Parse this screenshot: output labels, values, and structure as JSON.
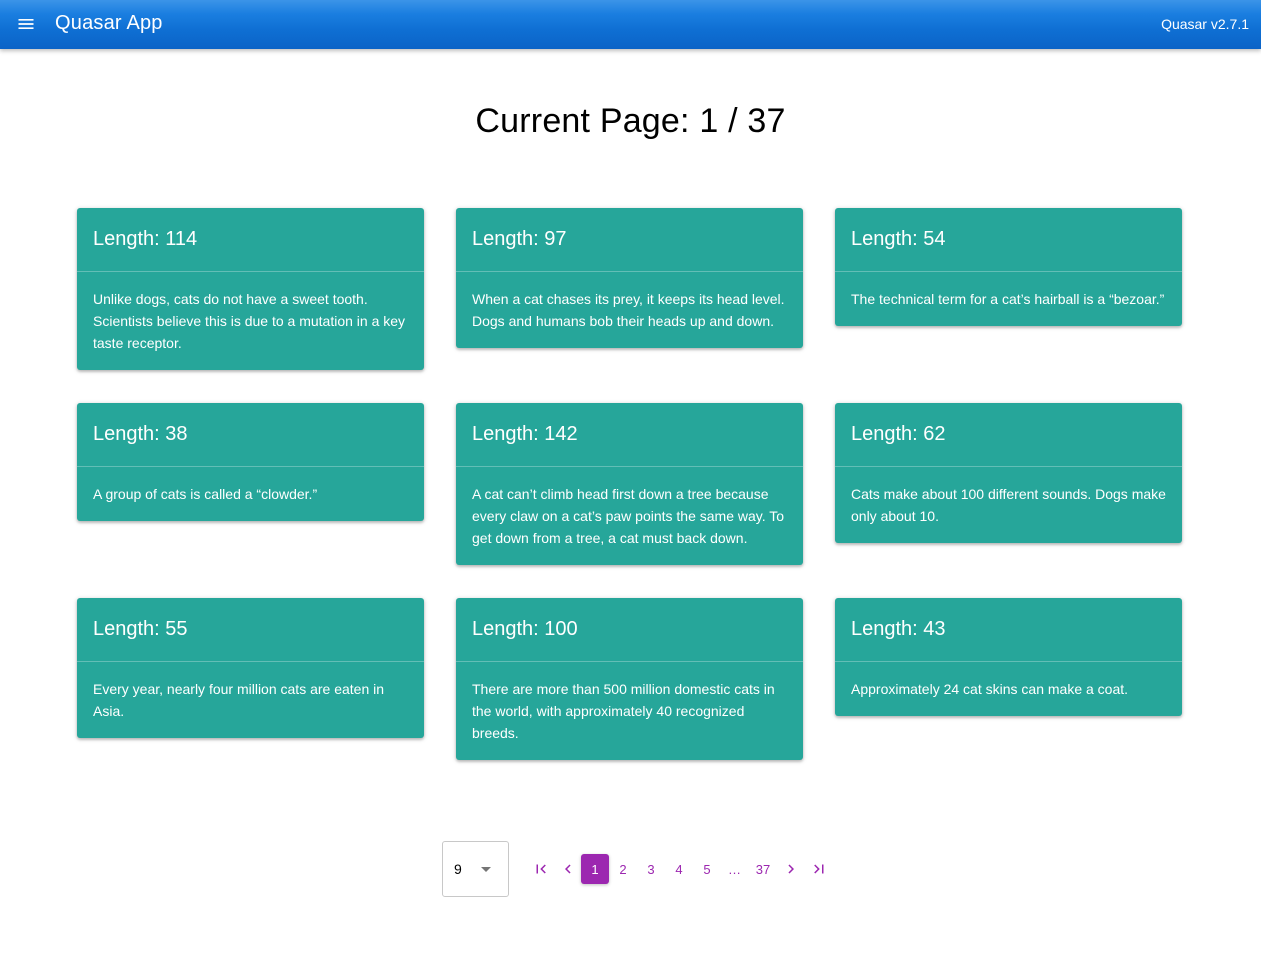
{
  "header": {
    "app_title": "Quasar App",
    "version": "Quasar v2.7.1",
    "menu_icon": "menu-icon"
  },
  "main": {
    "page_title": "Current Page: 1 / 37",
    "cards": [
      {
        "title": "Length: 114",
        "text": "Unlike dogs, cats do not have a sweet tooth. Scientists believe this is due to a mutation in a key taste receptor."
      },
      {
        "title": "Length: 97",
        "text": "When a cat chases its prey, it keeps its head level. Dogs and humans bob their heads up and down."
      },
      {
        "title": "Length: 54",
        "text": "The technical term for a cat’s hairball is a “bezoar.”"
      },
      {
        "title": "Length: 38",
        "text": "A group of cats is called a “clowder.”"
      },
      {
        "title": "Length: 142",
        "text": "A cat can’t climb head first down a tree because every claw on a cat’s paw points the same way. To get down from a tree, a cat must back down."
      },
      {
        "title": "Length: 62",
        "text": "Cats make about 100 different sounds. Dogs make only about 10."
      },
      {
        "title": "Length: 55",
        "text": "Every year, nearly four million cats are eaten in Asia."
      },
      {
        "title": "Length: 100",
        "text": "There are more than 500 million domestic cats in the world, with approximately 40 recognized breeds."
      },
      {
        "title": "Length: 43",
        "text": "Approximately 24 cat skins can make a coat."
      }
    ]
  },
  "pagination": {
    "per_page": "9",
    "pages": [
      "1",
      "2",
      "3",
      "4",
      "5",
      "…",
      "37"
    ],
    "current": "1",
    "icons": {
      "first": "first-page-icon",
      "prev": "chevron-left-icon",
      "next": "chevron-right-icon",
      "last": "last-page-icon",
      "dropdown": "caret-down-icon"
    },
    "accent_color": "#9c27b0"
  },
  "colors": {
    "header": "#1976d2",
    "card": "#26a69a"
  }
}
